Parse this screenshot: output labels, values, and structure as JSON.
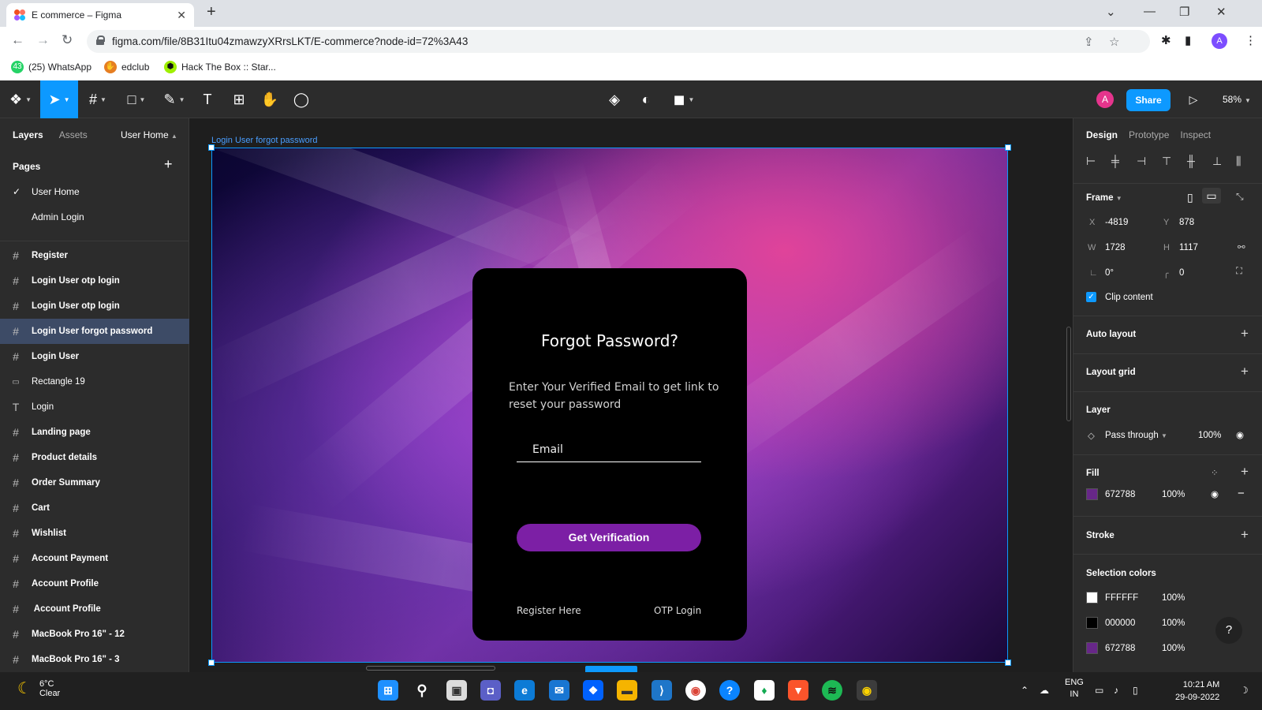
{
  "browser": {
    "tab_title": "E commerce – Figma",
    "url": "figma.com/file/8B31Itu04zmawzyXRrsLKT/E-commerce?node-id=72%3A43",
    "bookmarks": [
      {
        "label": "(25) WhatsApp",
        "icon": "whatsapp-icon",
        "color": "#25d366"
      },
      {
        "label": "edclub",
        "icon": "edclub-icon",
        "color": "#e67e22"
      },
      {
        "label": "Hack The Box :: Star...",
        "icon": "htb-icon",
        "color": "#9fef00"
      }
    ],
    "profile_initial": "A",
    "whatsapp_badge": "43"
  },
  "figma_toolbar": {
    "share_label": "Share",
    "avatar_initial": "A",
    "zoom": "58%"
  },
  "left_panel": {
    "tab_layers": "Layers",
    "tab_assets": "Assets",
    "current_page": "User Home",
    "pages_heading": "Pages",
    "pages": [
      {
        "label": "User Home",
        "checked": true
      },
      {
        "label": "Admin Login",
        "checked": false
      }
    ],
    "layers": [
      {
        "label": "Register",
        "icon": "frame-icon"
      },
      {
        "label": "Login User otp login",
        "icon": "frame-icon"
      },
      {
        "label": "Login User otp login",
        "icon": "frame-icon"
      },
      {
        "label": "Login User  forgot password",
        "icon": "frame-icon",
        "selected": true
      },
      {
        "label": "Login User",
        "icon": "frame-icon"
      },
      {
        "label": "Rectangle 19",
        "icon": "rectangle-icon"
      },
      {
        "label": "Login",
        "icon": "text-icon"
      },
      {
        "label": "Landing page",
        "icon": "frame-icon"
      },
      {
        "label": "Product details",
        "icon": "frame-icon"
      },
      {
        "label": "Order Summary",
        "icon": "frame-icon"
      },
      {
        "label": "Cart",
        "icon": "frame-icon"
      },
      {
        "label": "Wishlist",
        "icon": "frame-icon"
      },
      {
        "label": "Account Payment",
        "icon": "frame-icon"
      },
      {
        "label": "Account Profile",
        "icon": "frame-icon"
      },
      {
        "label": " Account Profile",
        "icon": "frame-icon"
      },
      {
        "label": "MacBook Pro 16\" - 12",
        "icon": "frame-icon"
      },
      {
        "label": "MacBook Pro 16\" - 3",
        "icon": "frame-icon"
      }
    ]
  },
  "canvas": {
    "frame_label": "Login User  forgot password",
    "card": {
      "title": "Forgot Password?",
      "description": "Enter Your Verified Email to get link to reset your password",
      "email_placeholder": "Email",
      "button_label": "Get Verification",
      "register_link": "Register Here",
      "otp_link": "OTP Login"
    }
  },
  "right_panel": {
    "tabs": [
      "Design",
      "Prototype",
      "Inspect"
    ],
    "frame_heading": "Frame",
    "x_label": "X",
    "x": "-4819",
    "y_label": "Y",
    "y": "878",
    "w_label": "W",
    "w": "1728",
    "h_label": "H",
    "h": "1117",
    "rotation": "0°",
    "radius": "0",
    "clip_content": "Clip content",
    "auto_layout": "Auto layout",
    "layout_grid": "Layout grid",
    "layer_heading": "Layer",
    "blend_mode": "Pass through",
    "layer_opacity": "100%",
    "fill_heading": "Fill",
    "fill": {
      "hex": "672788",
      "opacity": "100%",
      "color": "#672788"
    },
    "stroke_heading": "Stroke",
    "selection_colors_heading": "Selection colors",
    "selection_colors": [
      {
        "hex": "FFFFFF",
        "opacity": "100%",
        "color": "#FFFFFF"
      },
      {
        "hex": "000000",
        "opacity": "100%",
        "color": "#000000"
      },
      {
        "hex": "672788",
        "opacity": "100%",
        "color": "#672788"
      }
    ],
    "help": "?"
  },
  "taskbar": {
    "temperature": "6°C",
    "condition": "Clear",
    "lang_top": "ENG",
    "lang_bottom": "IN",
    "time": "10:21 AM",
    "date": "29-09-2022"
  },
  "colors": {
    "figma_blue": "#0d99ff",
    "panel_bg": "#2c2c2c",
    "canvas_bg": "#1e1e1e",
    "button_purple": "#7c1fa5"
  }
}
